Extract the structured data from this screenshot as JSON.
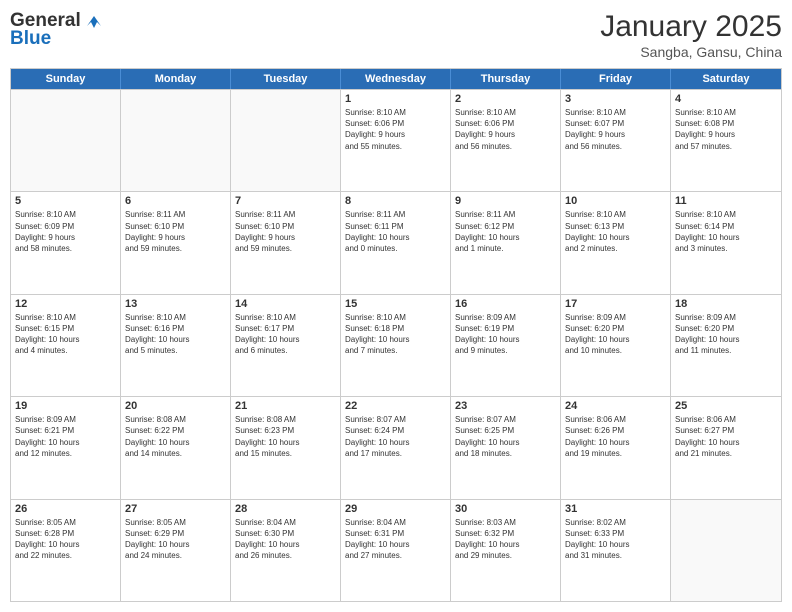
{
  "logo": {
    "line1": "General",
    "line2": "Blue"
  },
  "title": {
    "month_year": "January 2025",
    "location": "Sangba, Gansu, China"
  },
  "header_days": [
    "Sunday",
    "Monday",
    "Tuesday",
    "Wednesday",
    "Thursday",
    "Friday",
    "Saturday"
  ],
  "weeks": [
    [
      {
        "day": "",
        "text": ""
      },
      {
        "day": "",
        "text": ""
      },
      {
        "day": "",
        "text": ""
      },
      {
        "day": "1",
        "text": "Sunrise: 8:10 AM\nSunset: 6:06 PM\nDaylight: 9 hours\nand 55 minutes."
      },
      {
        "day": "2",
        "text": "Sunrise: 8:10 AM\nSunset: 6:06 PM\nDaylight: 9 hours\nand 56 minutes."
      },
      {
        "day": "3",
        "text": "Sunrise: 8:10 AM\nSunset: 6:07 PM\nDaylight: 9 hours\nand 56 minutes."
      },
      {
        "day": "4",
        "text": "Sunrise: 8:10 AM\nSunset: 6:08 PM\nDaylight: 9 hours\nand 57 minutes."
      }
    ],
    [
      {
        "day": "5",
        "text": "Sunrise: 8:10 AM\nSunset: 6:09 PM\nDaylight: 9 hours\nand 58 minutes."
      },
      {
        "day": "6",
        "text": "Sunrise: 8:11 AM\nSunset: 6:10 PM\nDaylight: 9 hours\nand 59 minutes."
      },
      {
        "day": "7",
        "text": "Sunrise: 8:11 AM\nSunset: 6:10 PM\nDaylight: 9 hours\nand 59 minutes."
      },
      {
        "day": "8",
        "text": "Sunrise: 8:11 AM\nSunset: 6:11 PM\nDaylight: 10 hours\nand 0 minutes."
      },
      {
        "day": "9",
        "text": "Sunrise: 8:11 AM\nSunset: 6:12 PM\nDaylight: 10 hours\nand 1 minute."
      },
      {
        "day": "10",
        "text": "Sunrise: 8:10 AM\nSunset: 6:13 PM\nDaylight: 10 hours\nand 2 minutes."
      },
      {
        "day": "11",
        "text": "Sunrise: 8:10 AM\nSunset: 6:14 PM\nDaylight: 10 hours\nand 3 minutes."
      }
    ],
    [
      {
        "day": "12",
        "text": "Sunrise: 8:10 AM\nSunset: 6:15 PM\nDaylight: 10 hours\nand 4 minutes."
      },
      {
        "day": "13",
        "text": "Sunrise: 8:10 AM\nSunset: 6:16 PM\nDaylight: 10 hours\nand 5 minutes."
      },
      {
        "day": "14",
        "text": "Sunrise: 8:10 AM\nSunset: 6:17 PM\nDaylight: 10 hours\nand 6 minutes."
      },
      {
        "day": "15",
        "text": "Sunrise: 8:10 AM\nSunset: 6:18 PM\nDaylight: 10 hours\nand 7 minutes."
      },
      {
        "day": "16",
        "text": "Sunrise: 8:09 AM\nSunset: 6:19 PM\nDaylight: 10 hours\nand 9 minutes."
      },
      {
        "day": "17",
        "text": "Sunrise: 8:09 AM\nSunset: 6:20 PM\nDaylight: 10 hours\nand 10 minutes."
      },
      {
        "day": "18",
        "text": "Sunrise: 8:09 AM\nSunset: 6:20 PM\nDaylight: 10 hours\nand 11 minutes."
      }
    ],
    [
      {
        "day": "19",
        "text": "Sunrise: 8:09 AM\nSunset: 6:21 PM\nDaylight: 10 hours\nand 12 minutes."
      },
      {
        "day": "20",
        "text": "Sunrise: 8:08 AM\nSunset: 6:22 PM\nDaylight: 10 hours\nand 14 minutes."
      },
      {
        "day": "21",
        "text": "Sunrise: 8:08 AM\nSunset: 6:23 PM\nDaylight: 10 hours\nand 15 minutes."
      },
      {
        "day": "22",
        "text": "Sunrise: 8:07 AM\nSunset: 6:24 PM\nDaylight: 10 hours\nand 17 minutes."
      },
      {
        "day": "23",
        "text": "Sunrise: 8:07 AM\nSunset: 6:25 PM\nDaylight: 10 hours\nand 18 minutes."
      },
      {
        "day": "24",
        "text": "Sunrise: 8:06 AM\nSunset: 6:26 PM\nDaylight: 10 hours\nand 19 minutes."
      },
      {
        "day": "25",
        "text": "Sunrise: 8:06 AM\nSunset: 6:27 PM\nDaylight: 10 hours\nand 21 minutes."
      }
    ],
    [
      {
        "day": "26",
        "text": "Sunrise: 8:05 AM\nSunset: 6:28 PM\nDaylight: 10 hours\nand 22 minutes."
      },
      {
        "day": "27",
        "text": "Sunrise: 8:05 AM\nSunset: 6:29 PM\nDaylight: 10 hours\nand 24 minutes."
      },
      {
        "day": "28",
        "text": "Sunrise: 8:04 AM\nSunset: 6:30 PM\nDaylight: 10 hours\nand 26 minutes."
      },
      {
        "day": "29",
        "text": "Sunrise: 8:04 AM\nSunset: 6:31 PM\nDaylight: 10 hours\nand 27 minutes."
      },
      {
        "day": "30",
        "text": "Sunrise: 8:03 AM\nSunset: 6:32 PM\nDaylight: 10 hours\nand 29 minutes."
      },
      {
        "day": "31",
        "text": "Sunrise: 8:02 AM\nSunset: 6:33 PM\nDaylight: 10 hours\nand 31 minutes."
      },
      {
        "day": "",
        "text": ""
      }
    ]
  ]
}
